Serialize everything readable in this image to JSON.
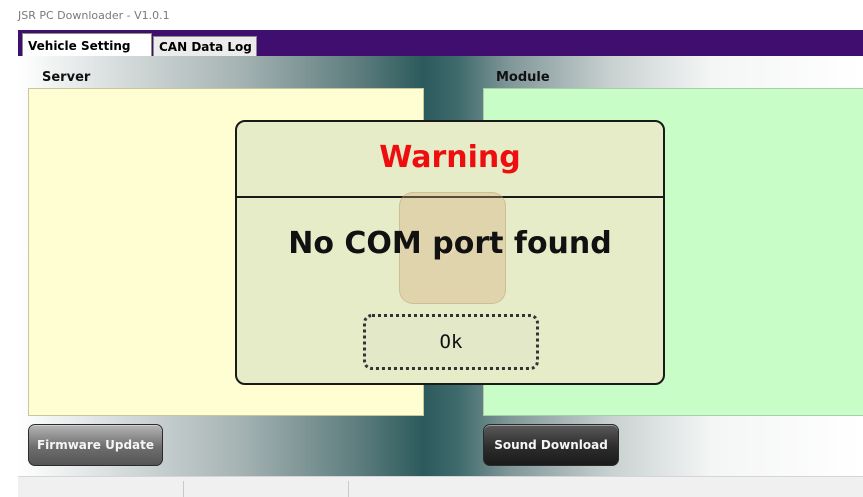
{
  "window": {
    "title": "JSR PC Downloader - V1.0.1"
  },
  "tabs": [
    {
      "label": "Vehicle Setting",
      "active": true
    },
    {
      "label": "CAN Data Log",
      "active": false
    }
  ],
  "panels": {
    "server": {
      "label": "Server"
    },
    "module": {
      "label": "Module"
    }
  },
  "buttons": {
    "firmware_update": "Firmware Update",
    "sound_download": "Sound Download"
  },
  "dialog": {
    "title": "Warning",
    "message": "No COM port found",
    "ok_label": "Ok"
  },
  "colors": {
    "tab_strip": "#3f0e6e",
    "server_panel": "#fffdd2",
    "module_panel": "#c8fdc8",
    "dialog_title": "#ee0e10",
    "dialog_bg": "#e6ecc8"
  }
}
